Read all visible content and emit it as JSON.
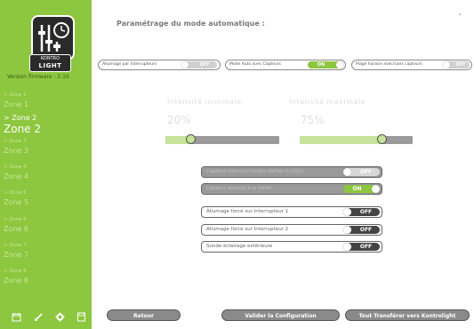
{
  "colors": {
    "accent": "#8dc63f",
    "sidebar_bg": "#8dc63f",
    "button_bg": "#8a8a8a",
    "toggle_off_dark": "#444444"
  },
  "sidebar": {
    "brand_top": "KONTRO",
    "brand_bottom": "LIGHT",
    "version": "Version firmware : 2.10",
    "zones": [
      {
        "sub": "> Zone 1",
        "main": "Zone 1",
        "active": false
      },
      {
        "sub": "> Zone 2",
        "main": "Zone 2",
        "active": true
      },
      {
        "sub": "> Zone 3",
        "main": "Zone 3",
        "active": false
      },
      {
        "sub": "> Zone 4",
        "main": "Zone 4",
        "active": false
      },
      {
        "sub": "> Zone 5",
        "main": "Zone 5",
        "active": false
      },
      {
        "sub": "> Zone 6",
        "main": "Zone 6",
        "active": false
      },
      {
        "sub": "> Zone 7",
        "main": "Zone 7",
        "active": false
      },
      {
        "sub": "> Zone 8",
        "main": "Zone 8",
        "active": false
      }
    ],
    "icons": [
      "calendar-icon",
      "brush-icon",
      "gear-icon",
      "save-icon"
    ]
  },
  "main": {
    "title": "Paramétrage du mode automatique :",
    "top_toggles": [
      {
        "label": "Allumage par Interrupteurs",
        "state": "OFF"
      },
      {
        "label": "Mode Auto avec Capteurs",
        "state": "ON"
      },
      {
        "label": "Plage horaire avec/sans capteurs",
        "state": "OFF"
      }
    ],
    "intensity_min": {
      "label": "Intensité minimale",
      "value": "20%",
      "level": 0.2
    },
    "intensity_max": {
      "label": "Intensité maximale",
      "value": "75%",
      "level": 0.75
    },
    "sensor_options": [
      {
        "label": "Capteur commun toutes sorties (L1/G1)",
        "state": "OFF"
      },
      {
        "label": "Capteur associé à la sortie",
        "state": "ON"
      }
    ],
    "forced_options": [
      {
        "label": "Allumage forcé sur Interrupteur 1",
        "state": "OFF"
      },
      {
        "label": "Allumage forcé sur Interrupteur 2",
        "state": "OFF"
      },
      {
        "label": "Sonde éclairage extérieure",
        "state": "OFF"
      }
    ],
    "buttons": {
      "back": "Retour",
      "validate": "Valider la Configuration",
      "transfer": "Tout Transférer vers Kontrolight"
    }
  }
}
